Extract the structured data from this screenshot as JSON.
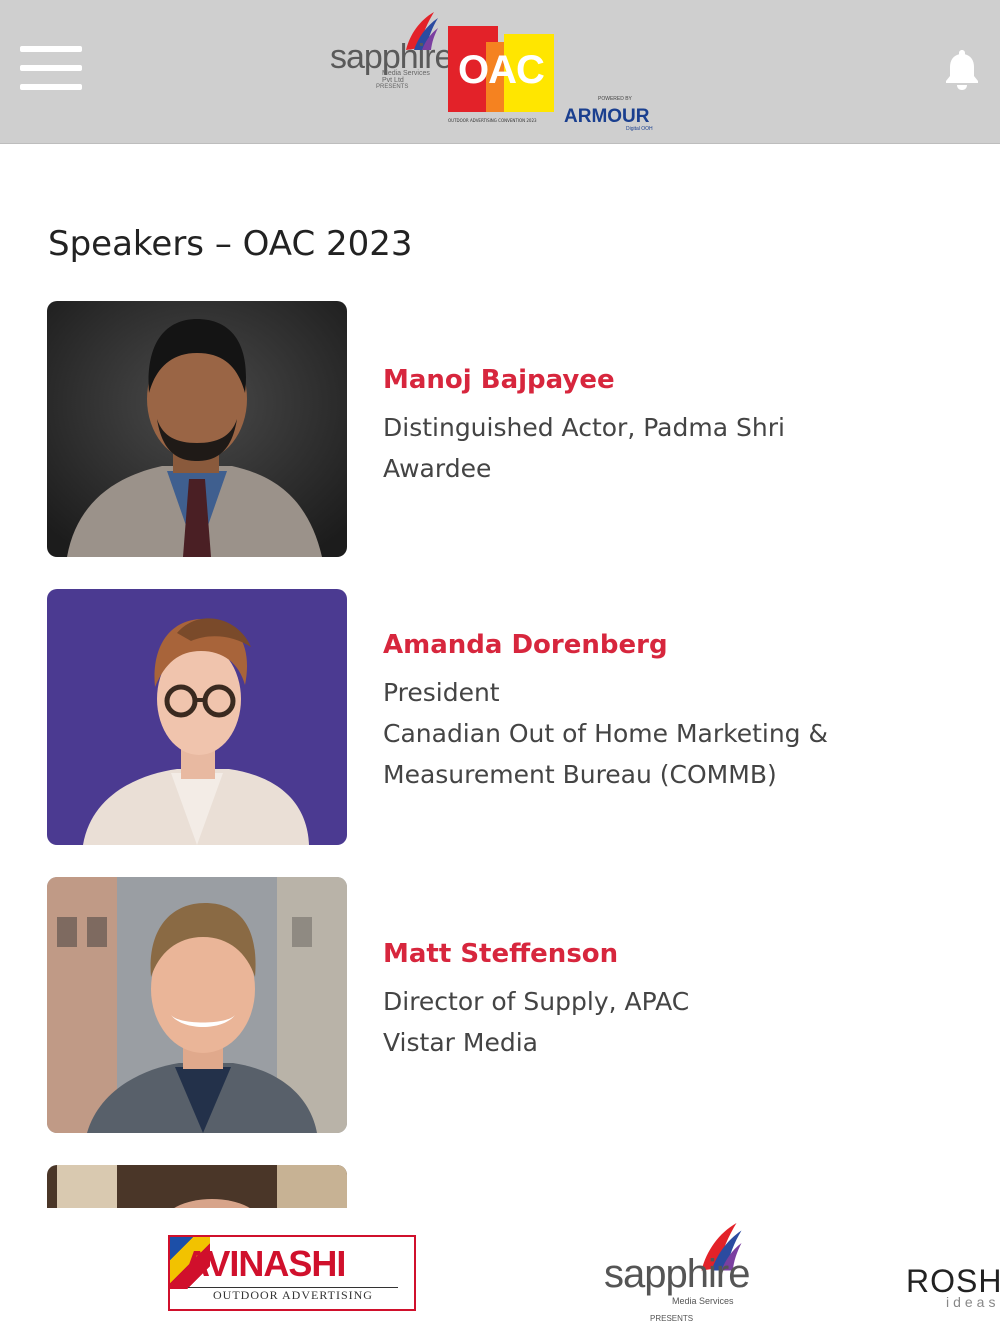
{
  "header": {
    "brand": {
      "name": "sapphire",
      "sub": "Media Services Pvt Ltd",
      "presents": "PRESENTS"
    },
    "oac": {
      "text": "OAC",
      "tagline": "OUTDOOR ADVERTISING CONVENTION 2023"
    },
    "armour": {
      "powered_by": "POWERED BY",
      "name": "ARMOUR",
      "sub": "Digital OOH"
    },
    "menu_icon": "hamburger-menu-icon",
    "notification_icon": "bell-icon"
  },
  "page": {
    "title": "Speakers – OAC 2023"
  },
  "speakers": [
    {
      "name": "Manoj Bajpayee",
      "role_lines": [
        "Distinguished Actor, Padma Shri",
        "Awardee"
      ],
      "photo_bg": "#2a2a2a"
    },
    {
      "name": "Amanda Dorenberg",
      "role_lines": [
        "President",
        "Canadian Out of Home Marketing &",
        "Measurement Bureau (COMMB)"
      ],
      "photo_bg": "#4b3a91"
    },
    {
      "name": "Matt Steffenson",
      "role_lines": [
        "Director of Supply, APAC",
        "Vistar Media"
      ],
      "photo_bg": "#8c8f93"
    }
  ],
  "sponsors": {
    "avinashi": {
      "name": "AVINASHI",
      "tagline": "OUTDOOR ADVERTISING"
    },
    "sapphire": {
      "name": "sapphire",
      "sub": "Media Services",
      "presents": "PRESENTS"
    },
    "rosh": {
      "name": "ROSH",
      "sub": "ideas"
    }
  },
  "colors": {
    "header_bg": "#cfcfcf",
    "accent_red": "#d7263d"
  }
}
